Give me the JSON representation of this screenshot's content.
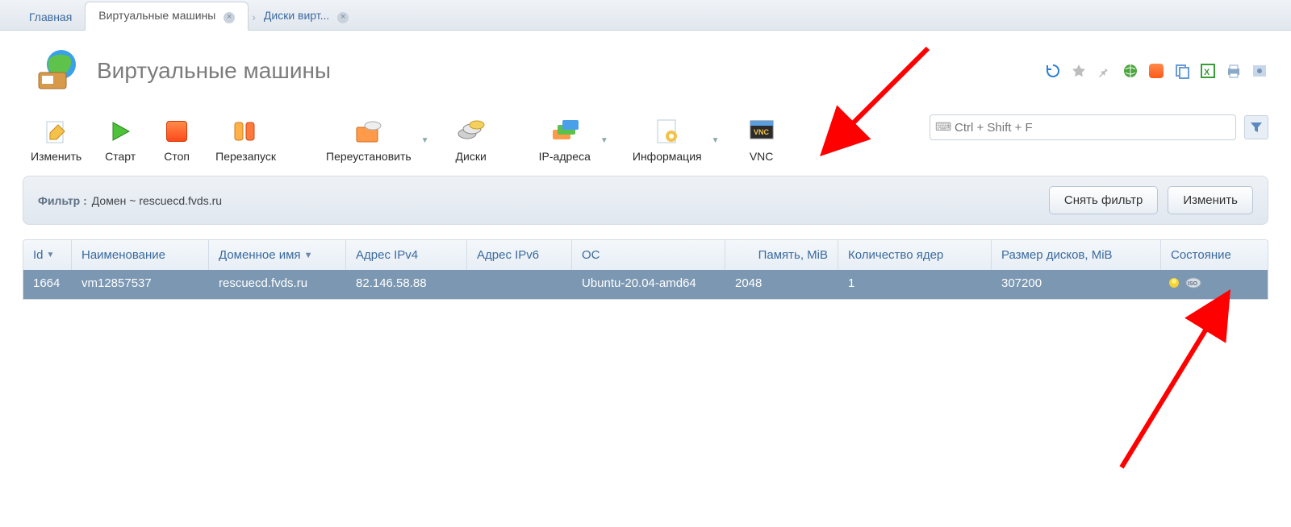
{
  "tabs": {
    "home": "Главная",
    "vms": "Виртуальные машины",
    "disks": "Диски вирт..."
  },
  "page_title": "Виртуальные машины",
  "toolbar": {
    "edit": "Изменить",
    "start": "Старт",
    "stop": "Стоп",
    "restart": "Перезапуск",
    "reinstall": "Переустановить",
    "disks": "Диски",
    "ips": "IP-адреса",
    "info": "Информация",
    "vnc": "VNC"
  },
  "search": {
    "placeholder": "Ctrl + Shift + F"
  },
  "filter": {
    "label": "Фильтр :",
    "value": "Домен ~ rescuecd.fvds.ru",
    "clear": "Снять фильтр",
    "edit": "Изменить"
  },
  "columns": {
    "id": "Id",
    "name": "Наименование",
    "domain": "Доменное имя",
    "ipv4": "Адрес IPv4",
    "ipv6": "Адрес IPv6",
    "os": "ОС",
    "mem": "Память, MiB",
    "cores": "Количество ядер",
    "disk": "Размер дисков, MiB",
    "state": "Состояние"
  },
  "rows": [
    {
      "id": "1664",
      "name": "vm12857537",
      "domain": "rescuecd.fvds.ru",
      "ipv4": "82.146.58.88",
      "ipv6": "",
      "os": "Ubuntu-20.04-amd64",
      "mem": "2048",
      "cores": "1",
      "disk": "307200"
    }
  ]
}
